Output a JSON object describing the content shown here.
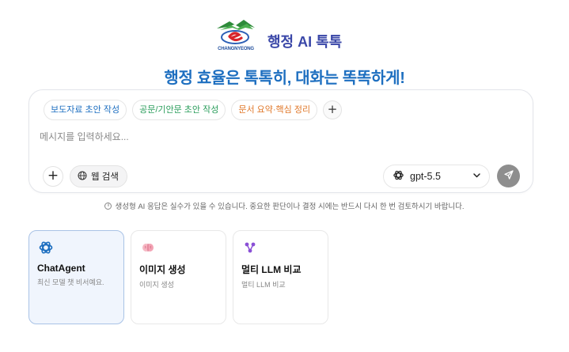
{
  "header": {
    "logo_text": "CHANGNYEONG",
    "app_title": "행정 AI 톡톡"
  },
  "headline": "행정 효율은 톡톡히, 대화는 똑똑하게!",
  "composer": {
    "chips": [
      {
        "label": "보도자료 초안 작성",
        "color": "#1e6fc0",
        "icon": "none"
      },
      {
        "label": "공문/기안문 초안 작성",
        "color": "#2a9d5b",
        "icon": "none"
      },
      {
        "label": "문서 요약·핵심 정리",
        "color": "#e0782a",
        "icon": "none"
      }
    ],
    "add_chip_icon": "+",
    "placeholder": "메시지를 입력하세요...",
    "value": "",
    "plus_icon": "+",
    "web_search_label": "웹 검색",
    "model_name": "gpt-5.5"
  },
  "disclaimer": "생성형 AI 응답은 실수가 있을 수 있습니다. 중요한 판단이나 결정 시에는 반드시 다시 한 번 검토하시기 바랍니다.",
  "cards": [
    {
      "title": "ChatAgent",
      "desc": "최신 모델 챗 비서예요.",
      "icon": "openai-icon",
      "active": true
    },
    {
      "title": "이미지 생성",
      "desc": "이미지 생성",
      "icon": "brain-icon",
      "active": false
    },
    {
      "title": "멀티 LLM 비교",
      "desc": "멀티 LLM 비교",
      "icon": "nodes-icon",
      "active": false
    }
  ],
  "colors": {
    "title": "#3a47a8",
    "headline": "#1e6fc0",
    "active_card_bg": "#f0f5fd",
    "send_button": "#8e8e8e"
  }
}
